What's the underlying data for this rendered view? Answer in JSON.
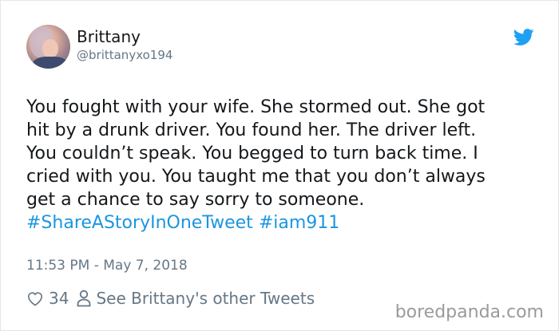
{
  "user": {
    "name": "Brittany",
    "handle": "@brittanyxo194"
  },
  "tweet": {
    "lines": [
      "You fought with your wife. She stormed out. She got",
      "hit by a drunk driver. You found her. The driver left.",
      "You couldn’t speak. You begged to turn back time. I",
      "cried with you. You taught me that you don’t always",
      "get a chance to say sorry to someone."
    ],
    "hashtags": [
      "#ShareAStoryInOneTweet",
      "#iam911"
    ],
    "timestamp": "11:53 PM - May 7, 2018"
  },
  "actions": {
    "like_count": "34",
    "see_other_tweets": "See Brittany's other Tweets"
  },
  "watermark": "boredpanda.com",
  "colors": {
    "link": "#1b95e0",
    "muted": "#657786",
    "text": "#14171a",
    "twitter_blue": "#1da1f2"
  },
  "icons": [
    "twitter-bird-icon",
    "heart-icon",
    "person-icon"
  ]
}
